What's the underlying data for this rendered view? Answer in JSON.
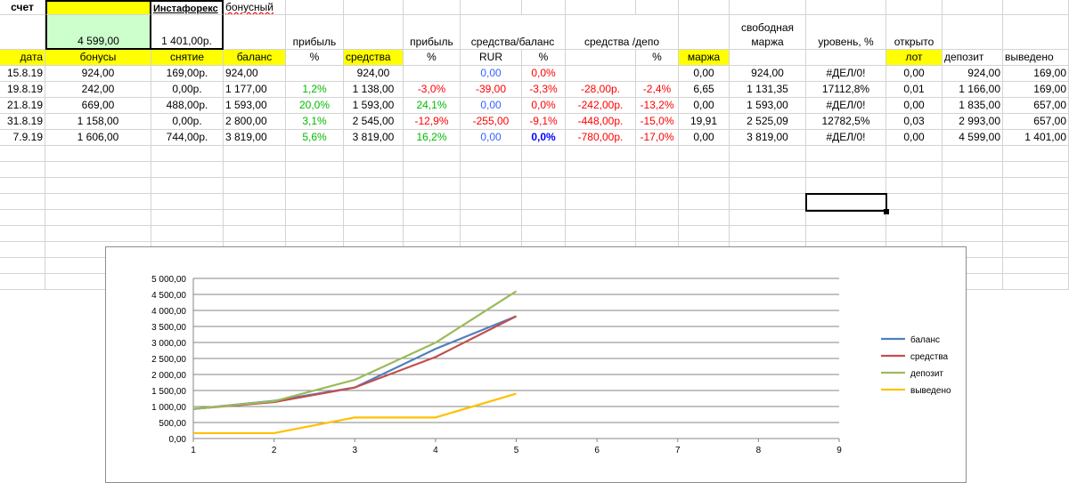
{
  "sheet": {
    "top_row": {
      "label_schet": "счет",
      "label_instaforex": "Инстафорекс",
      "label_bonus": "бонусный"
    },
    "second_row": {
      "deposit_total": "4 599,00",
      "withdraw_total": "1 401,00р.",
      "h_pribyl1": "прибыль",
      "h_pribyl2": "прибыль",
      "h_sredstva_balans": "средства/баланс",
      "h_sredstva_depo": "средства /депо",
      "h_svobodnaya_marzha": "свободная маржа",
      "h_uroven": "уровень, %",
      "h_otkryto": "открыто"
    },
    "header_row": {
      "data": "дата",
      "bonusy": "бонусы",
      "snyatie": "снятие",
      "balans": "баланс",
      "pct1": "%",
      "sredstva": "средства",
      "pct2": "%",
      "rur": "RUR",
      "pct3": "%",
      "pct4": "%",
      "marzha": "маржа",
      "lot": "лот",
      "depozit": "депозит",
      "vyvedeno": "выведено"
    },
    "rows": [
      {
        "date": "15.8.19",
        "bonus": "924,00",
        "withdraw": "169,00р.",
        "balance": "924,00",
        "profit_pct": "",
        "funds": "924,00",
        "profit2_pct": "",
        "rur": "0,00",
        "fb_pct": "0,0%",
        "fd": "",
        "fd_pct": "",
        "margin": "0,00",
        "free_margin": "924,00",
        "level": "#ДЕЛ/0!",
        "lot": "0,00",
        "deposit": "924,00",
        "withdrawn": "169,00"
      },
      {
        "date": "19.8.19",
        "bonus": "242,00",
        "withdraw": "0,00р.",
        "balance": "1 177,00",
        "profit_pct": "1,2%",
        "funds": "1 138,00",
        "profit2_pct": "-3,0%",
        "rur": "-39,00",
        "fb_pct": "-3,3%",
        "fd": "-28,00р.",
        "fd_pct": "-2,4%",
        "margin": "6,65",
        "free_margin": "1 131,35",
        "level": "17112,8%",
        "lot": "0,01",
        "deposit": "1 166,00",
        "withdrawn": "169,00"
      },
      {
        "date": "21.8.19",
        "bonus": "669,00",
        "withdraw": "488,00р.",
        "balance": "1 593,00",
        "profit_pct": "20,0%",
        "funds": "1 593,00",
        "profit2_pct": "24,1%",
        "rur": "0,00",
        "fb_pct": "0,0%",
        "fd": "-242,00р.",
        "fd_pct": "-13,2%",
        "margin": "0,00",
        "free_margin": "1 593,00",
        "level": "#ДЕЛ/0!",
        "lot": "0,00",
        "deposit": "1 835,00",
        "withdrawn": "657,00"
      },
      {
        "date": "31.8.19",
        "bonus": "1 158,00",
        "withdraw": "0,00р.",
        "balance": "2 800,00",
        "profit_pct": "3,1%",
        "funds": "2 545,00",
        "profit2_pct": "-12,9%",
        "rur": "-255,00",
        "fb_pct": "-9,1%",
        "fd": "-448,00р.",
        "fd_pct": "-15,0%",
        "margin": "19,91",
        "free_margin": "2 525,09",
        "level": "12782,5%",
        "lot": "0,03",
        "deposit": "2 993,00",
        "withdrawn": "657,00"
      },
      {
        "date": "7.9.19",
        "bonus": "1 606,00",
        "withdraw": "744,00р.",
        "balance": "3 819,00",
        "profit_pct": "5,6%",
        "funds": "3 819,00",
        "profit2_pct": "16,2%",
        "rur": "0,00",
        "fb_pct": "0,0%",
        "fd": "-780,00р.",
        "fd_pct": "-17,0%",
        "margin": "0,00",
        "free_margin": "3 819,00",
        "level": "#ДЕЛ/0!",
        "lot": "0,00",
        "deposit": "4 599,00",
        "withdrawn": "1 401,00"
      }
    ]
  },
  "colors": {
    "highlight": "#ffff00",
    "green_cell": "#ccffcc",
    "positive": "#00bb00",
    "negative": "#ff0000",
    "neutral": "#3366ff"
  },
  "chart_data": {
    "type": "line",
    "x": [
      1,
      2,
      3,
      4,
      5
    ],
    "xticks": [
      "1",
      "2",
      "3",
      "4",
      "5",
      "6",
      "7",
      "8",
      "9"
    ],
    "xlim": [
      1,
      9
    ],
    "ylim": [
      0,
      5000
    ],
    "yticks": [
      "0,00",
      "500,00",
      "1 000,00",
      "1 500,00",
      "2 000,00",
      "2 500,00",
      "3 000,00",
      "3 500,00",
      "4 000,00",
      "4 500,00",
      "5 000,00"
    ],
    "grid": true,
    "legend_position": "right",
    "series": [
      {
        "name": "баланс",
        "color": "#4f81bd",
        "values": [
          924,
          1177,
          1593,
          2800,
          3819
        ]
      },
      {
        "name": "средства",
        "color": "#c0504d",
        "values": [
          924,
          1138,
          1593,
          2545,
          3819
        ]
      },
      {
        "name": "депозит",
        "color": "#9bbb59",
        "values": [
          924,
          1166,
          1835,
          2993,
          4599
        ]
      },
      {
        "name": "выведено",
        "color": "#ffc000",
        "values": [
          169,
          169,
          657,
          657,
          1401
        ]
      }
    ]
  }
}
